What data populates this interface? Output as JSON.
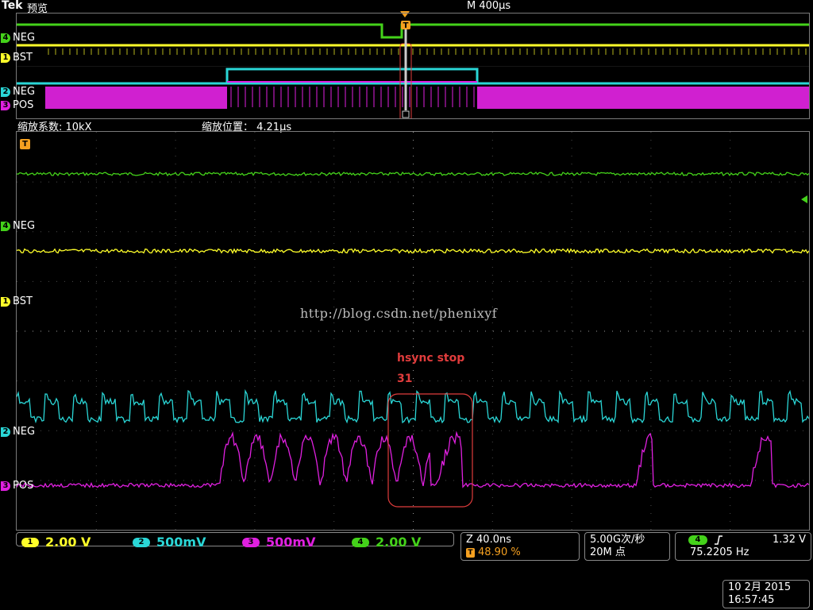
{
  "header": {
    "brand": "Tek",
    "mode": "预览",
    "timebase": "M 400µs"
  },
  "overview": {
    "channels": [
      {
        "num": "4",
        "name": "NEG",
        "color": "#44d21a"
      },
      {
        "num": "1",
        "name": "BST",
        "color": "#ffff2a"
      },
      {
        "num": "2",
        "name": "NEG",
        "color": "#2ad6d6"
      },
      {
        "num": "3",
        "name": "POS",
        "color": "#e020e0"
      }
    ],
    "trigger_marker": "T"
  },
  "zoom": {
    "factor": "缩放系数: 10kX",
    "position": "缩放位置： 4.21µs"
  },
  "main": {
    "trigger_marker": "T",
    "channel_labels": [
      {
        "num": "4",
        "name": "NEG",
        "color": "#44d21a"
      },
      {
        "num": "1",
        "name": "BST",
        "color": "#ffff2a"
      },
      {
        "num": "2",
        "name": "NEG",
        "color": "#2ad6d6"
      },
      {
        "num": "3",
        "name": "POS",
        "color": "#e020e0"
      }
    ],
    "annotation": {
      "title": "hsync stop",
      "number": "31"
    },
    "watermark": "http://blog.csdn.net/phenixyf"
  },
  "channel_settings": [
    {
      "num": "1",
      "scale": "2.00 V",
      "color": "#ffff2a"
    },
    {
      "num": "2",
      "scale": "500mV",
      "color": "#2ad6d6"
    },
    {
      "num": "3",
      "scale": "500mV",
      "color": "#e020e0"
    },
    {
      "num": "4",
      "scale": "2.00 V",
      "color": "#44d21a"
    }
  ],
  "horizontal": {
    "zoom_scale": "Z 40.0ns",
    "trigger_pos_marker": "T",
    "trigger_pos": "48.90 %"
  },
  "acquisition": {
    "sample_rate": "5.00G次/秒",
    "record_length": "20M 点"
  },
  "trigger": {
    "source": "4",
    "slope_icon": "rising-edge-icon",
    "level": "1.32 V",
    "frequency": "75.2205 Hz"
  },
  "datetime": {
    "date": "10 2月  2015",
    "time": "16:57:45"
  }
}
